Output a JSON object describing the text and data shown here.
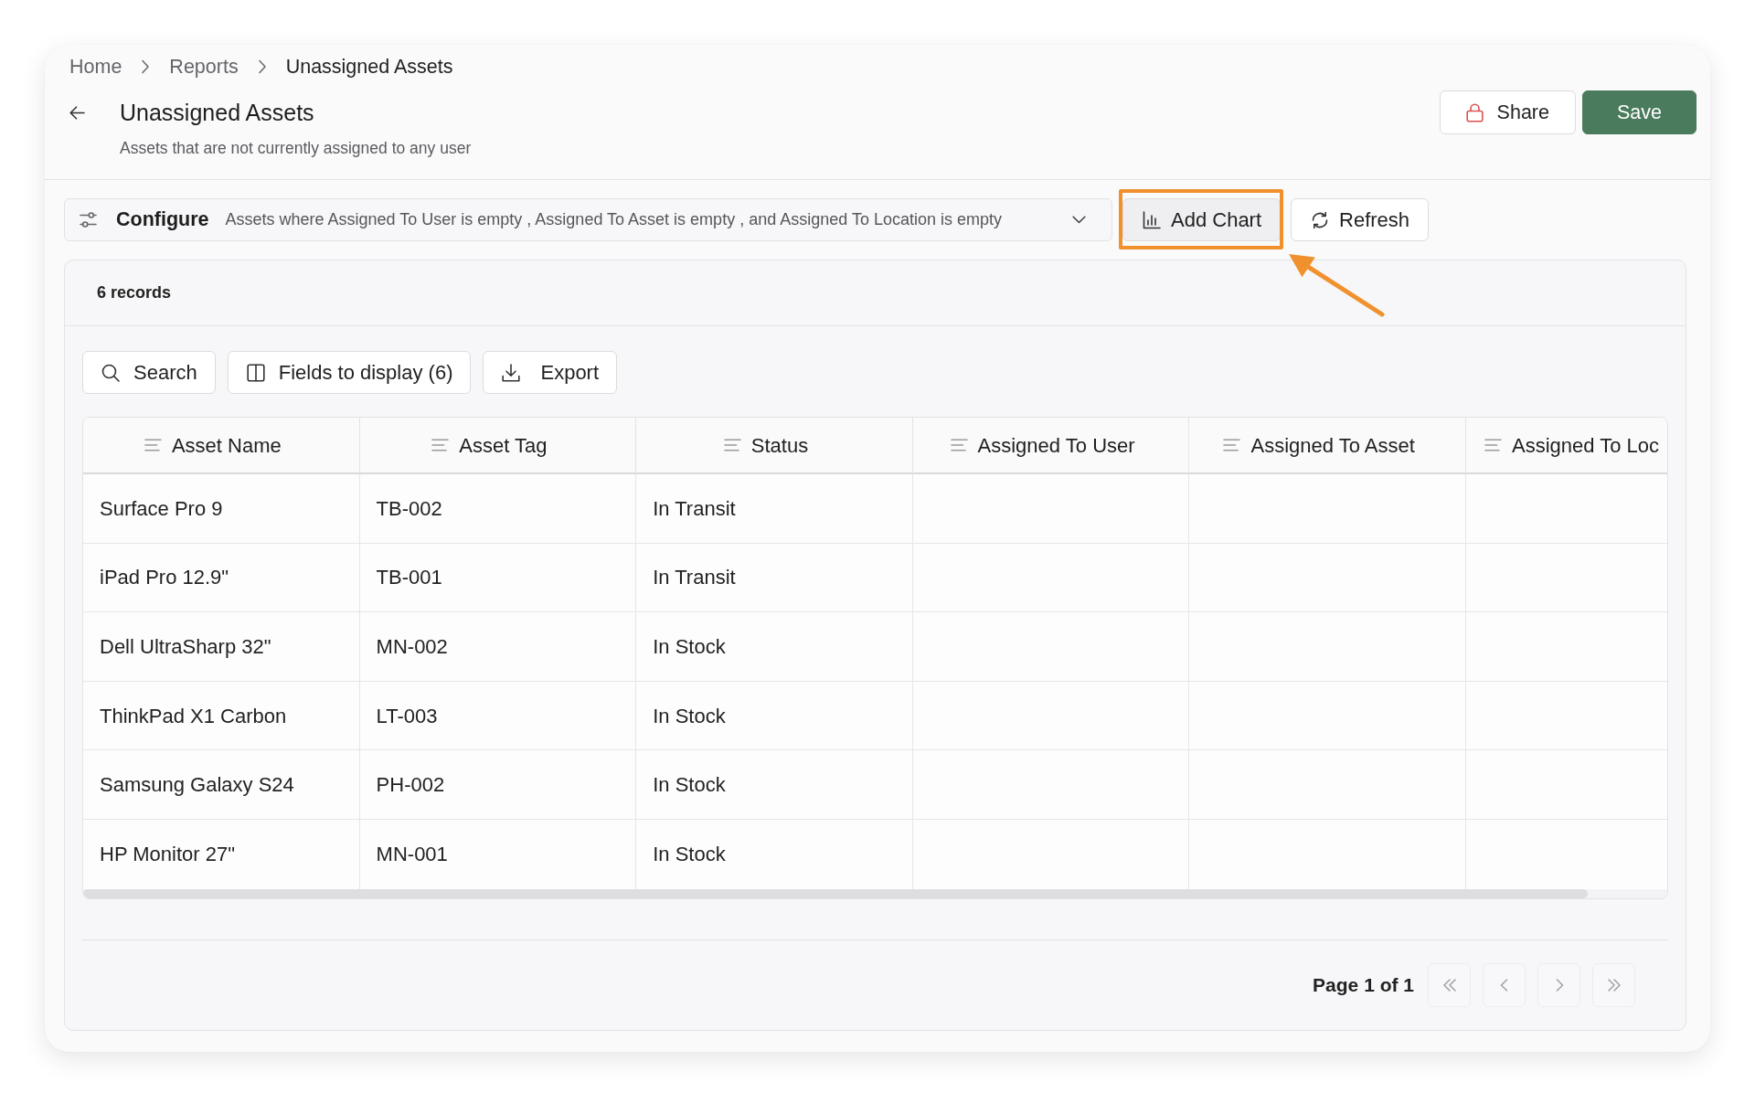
{
  "breadcrumb": [
    {
      "label": "Home",
      "current": false
    },
    {
      "label": "Reports",
      "current": false
    },
    {
      "label": "Unassigned Assets",
      "current": true
    }
  ],
  "page": {
    "title": "Unassigned Assets",
    "subtitle": "Assets that are not currently assigned to any user"
  },
  "header_actions": [
    {
      "label": "Share",
      "kind": "share"
    },
    {
      "label": "Save",
      "kind": "primary"
    }
  ],
  "filter_bar": {
    "label": "Configure",
    "summary": "Assets where Assigned To User is empty , Assigned To Asset is empty , and Assigned To Location is empty"
  },
  "filter_actions": [
    {
      "label": "Add Chart",
      "highlighted": true
    },
    {
      "label": "Refresh",
      "highlighted": false
    }
  ],
  "report": {
    "record_count": "6 records",
    "tools": [
      {
        "label": "Search"
      },
      {
        "label": "Fields to display (6)"
      },
      {
        "label": "Export"
      }
    ],
    "table": {
      "columns": [
        "Asset Name",
        "Asset Tag",
        "Status",
        "Assigned To User",
        "Assigned To Asset",
        "Assigned To Loc"
      ],
      "rows": [
        [
          "Surface Pro 9",
          "TB-002",
          "In Transit"
        ],
        [
          "iPad Pro 12.9\"",
          "TB-001",
          "In Transit"
        ],
        [
          "Dell UltraSharp 32\"",
          "MN-002",
          "In Stock"
        ],
        [
          "ThinkPad X1 Carbon",
          "LT-003",
          "In Stock"
        ],
        [
          "Samsung Galaxy S24",
          "PH-002",
          "In Stock"
        ],
        [
          "HP Monitor 27\"",
          "MN-001",
          "In Stock"
        ]
      ]
    },
    "pagination": {
      "label": "Page 1 of 1",
      "buttons": [
        {
          "disabled": true
        },
        {
          "disabled": true
        },
        {
          "disabled": true
        },
        {
          "disabled": true
        }
      ]
    }
  }
}
